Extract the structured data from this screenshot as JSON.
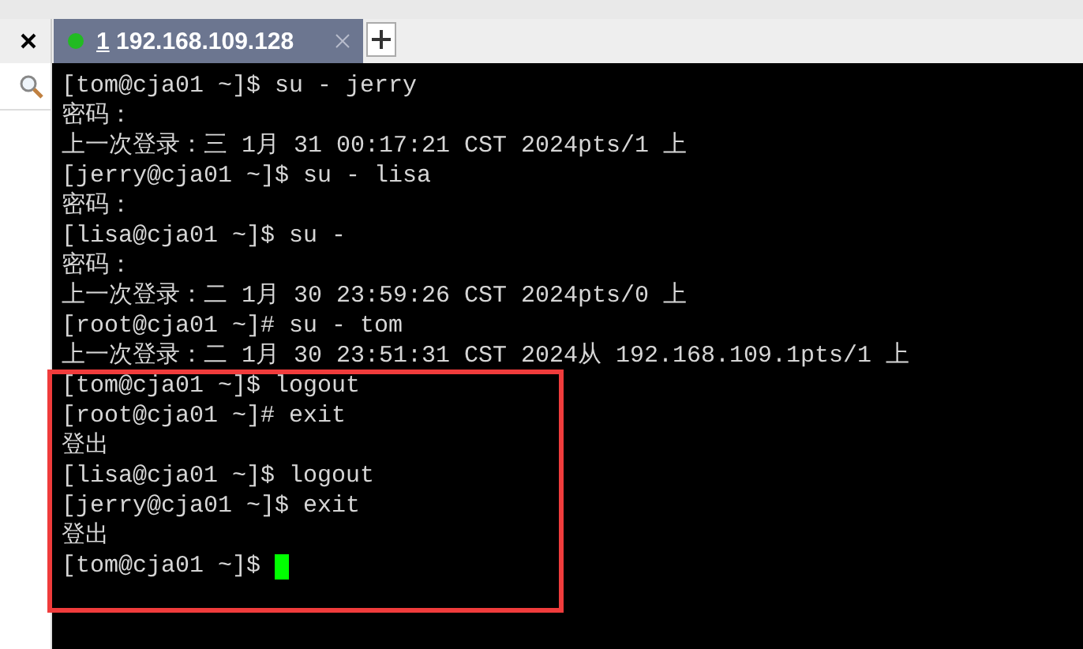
{
  "tabs": [
    {
      "number": "1",
      "label": " 192.168.109.128",
      "color": "#22bb22",
      "selected": true
    }
  ],
  "terminal": {
    "lines": [
      "[tom@cja01 ~]$ su - jerry",
      "密码：",
      "上一次登录：三 1月 31 00:17:21 CST 2024pts/1 上",
      "[jerry@cja01 ~]$ su - lisa",
      "密码：",
      "[lisa@cja01 ~]$ su -",
      "密码：",
      "上一次登录：二 1月 30 23:59:26 CST 2024pts/0 上",
      "[root@cja01 ~]# su - tom",
      "上一次登录：二 1月 30 23:51:31 CST 2024从 192.168.109.1pts/1 上",
      "[tom@cja01 ~]$ logout",
      "[root@cja01 ~]# exit",
      "登出",
      "[lisa@cja01 ~]$ logout",
      "[jerry@cja01 ~]$ exit",
      "登出",
      "[tom@cja01 ~]$ "
    ],
    "cursor": true
  }
}
